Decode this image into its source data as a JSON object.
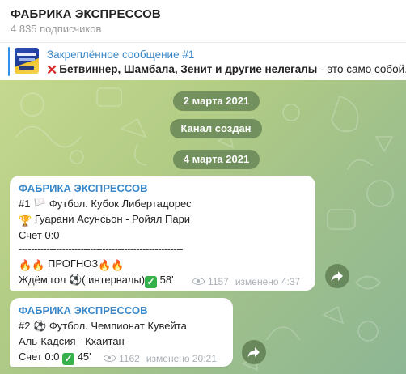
{
  "header": {
    "title": "ФАБРИКА ЭКСПРЕССОВ",
    "subscribers": "4 835 подписчиков"
  },
  "pinned": {
    "label": "Закреплённое сообщение #1",
    "text_bold": "Бетвиннер,  Шамбала, Зенит и другие нелегалы",
    "text_rest": " - это само собой."
  },
  "service": {
    "date1": "2 марта 2021",
    "created": "Канал создан",
    "date2": "4 марта 2021"
  },
  "messages": [
    {
      "sender": "ФАБРИКА ЭКСПРЕССОВ",
      "line1": "#1 🏳️ Футбол. Кубок Либертадорес",
      "line2": "Гуарани Асунсьон - Ройял Пари",
      "line3": "Счет 0:0",
      "separator": "-----------------------------------------------------",
      "line4": "ПРОГНОЗ",
      "line5": "Ждём гол ⚽( интервалы)",
      "line5_tail": " 58'",
      "views": "1157",
      "edited": "изменено 4:37"
    },
    {
      "sender": "ФАБРИКА ЭКСПРЕССОВ",
      "line1": "#2 ⚽ Футбол. Чемпионат Кувейта",
      "line2": "Аль-Кадсия - Кхаитан",
      "line3": "Счет 0:0",
      "line3_tail": " 45'",
      "views": "1162",
      "edited": "изменено 20:21"
    }
  ],
  "colors": {
    "accent": "#3a87c8",
    "bubble": "#ffffff",
    "check": "#35b14b",
    "cross": "#d62b2b"
  }
}
